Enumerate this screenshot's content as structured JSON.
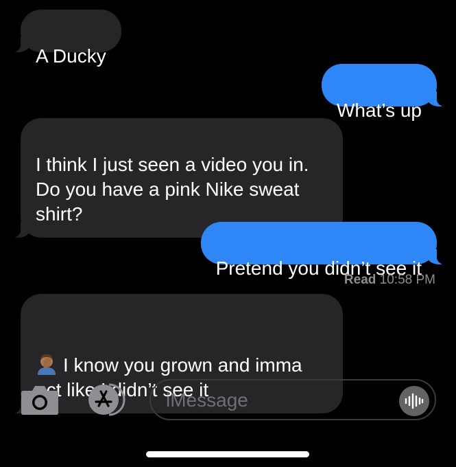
{
  "messages": {
    "m1": "A Ducky",
    "m2": "What’s up",
    "m3": "I think I just seen a video you in.\nDo you have a pink Nike sweat\nshirt?",
    "m4": "Pretend you didn’t see it",
    "m6": "I know you grown and imma\nact like I didn’t see it"
  },
  "receipt": {
    "status": "Read",
    "time": "10:58 PM"
  },
  "composer": {
    "placeholder": "iMessage"
  },
  "icons": {
    "camera": "camera-icon",
    "appstore": "app-store-icon",
    "audio": "audio-waveform-icon",
    "emoji": "face-palm-emoji"
  },
  "colors": {
    "background": "#000000",
    "incoming_bubble": "#262629",
    "outgoing_bubble": "#2f86f7",
    "secondary_text": "#8e8e93"
  }
}
